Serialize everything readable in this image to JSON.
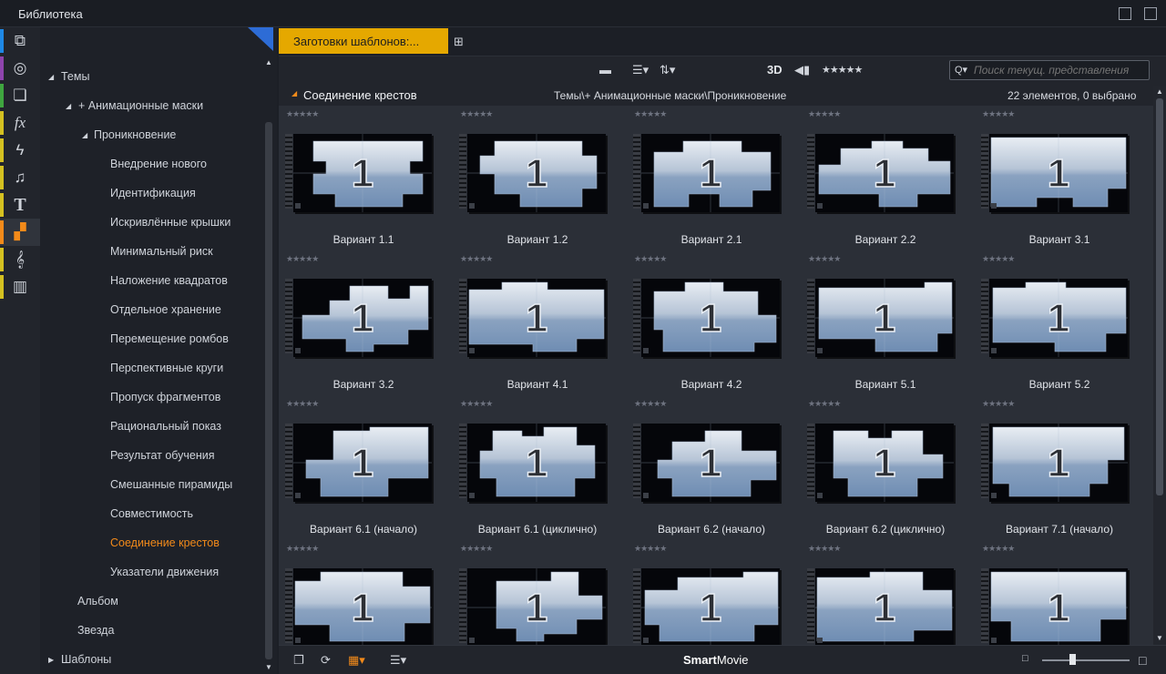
{
  "window": {
    "title": "Библиотека"
  },
  "iconbar": {
    "items": [
      {
        "icon": "project-bin-icon",
        "color": "#1e88e5"
      },
      {
        "icon": "film-reel-icon",
        "color": "#8e44ad"
      },
      {
        "icon": "photos-icon",
        "color": "#3fa63f"
      },
      {
        "icon": "fx-icon",
        "color": "#d4c021"
      },
      {
        "icon": "lightning-icon",
        "color": "#d4c021"
      },
      {
        "icon": "music-note-icon",
        "color": "#d4c021"
      },
      {
        "icon": "title-T-icon",
        "color": "#d4c021"
      },
      {
        "icon": "montage-icon",
        "color": "#f28a1a"
      },
      {
        "icon": "treble-clef-icon",
        "color": "#d4c021"
      },
      {
        "icon": "piano-keys-icon",
        "color": "#d4c021"
      }
    ],
    "active_index": 7
  },
  "tree": {
    "root": "Темы",
    "group": "+ Анимационные маски",
    "subgroup": "Проникновение",
    "items": [
      "Внедрение нового",
      "Идентификация",
      "Искривлённые крышки",
      "Минимальный риск",
      "Наложение квадратов",
      "Отдельное хранение",
      "Перемещение ромбов",
      "Перспективные круги",
      "Пропуск фрагментов",
      "Рациональный показ",
      "Результат обучения",
      "Смешанные пирамиды",
      "Совместимость",
      "Соединение крестов",
      "Указатели движения"
    ],
    "selected": "Соединение крестов",
    "siblings": [
      "Альбом",
      "Звезда"
    ],
    "collapsed_root": "Шаблоны"
  },
  "tabs": {
    "active_label": "Заготовки шаблонов:..."
  },
  "toolbar": {
    "mode_3d": "3D",
    "stars": "★★★★★",
    "search_placeholder": "Поиск текущ. представления"
  },
  "pathbar": {
    "title": "Соединение крестов",
    "path": "Темы\\+ Анимационные маски\\Проникновение",
    "count": "22 элементов, 0 выбрано"
  },
  "grid": {
    "stars": "★★★★★",
    "thumb_digit": "1",
    "items": [
      "Вариант 1.1",
      "Вариант 1.2",
      "Вариант 2.1",
      "Вариант 2.2",
      "Вариант 3.1",
      "Вариант 3.2",
      "Вариант 4.1",
      "Вариант 4.2",
      "Вариант 5.1",
      "Вариант 5.2",
      "Вариант 6.1 (начало)",
      "Вариант 6.1 (циклично)",
      "Вариант 6.2 (начало)",
      "Вариант 6.2 (циклично)",
      "Вариант 7.1 (начало)",
      "",
      "",
      "",
      "",
      ""
    ]
  },
  "statusbar": {
    "brand_bold": "Smart",
    "brand_rest": "Movie"
  },
  "colors": {
    "accent": "#f28a1a",
    "tab": "#e5a800",
    "highlight": "#2d6cd6"
  }
}
